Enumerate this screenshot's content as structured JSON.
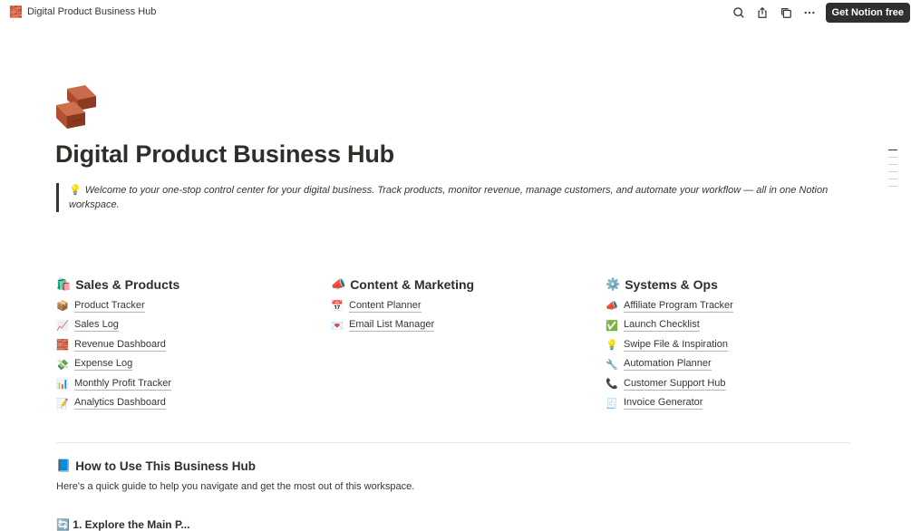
{
  "topbar": {
    "page_emoji": "🧱",
    "page_title": "Digital Product Business Hub",
    "cta_label": "Get Notion free"
  },
  "page": {
    "icon": "brick-icon",
    "title": "Digital Product Business Hub",
    "callout_emoji": "💡",
    "callout_text": "Welcome to your one-stop control center for your digital business. Track products, monitor revenue, manage customers, and automate your workflow — all in one Notion workspace."
  },
  "columns": [
    {
      "emoji": "🛍️",
      "heading": "Sales & Products",
      "links": [
        {
          "emoji": "📦",
          "label": "Product Tracker"
        },
        {
          "emoji": "📈",
          "label": "Sales Log"
        },
        {
          "emoji": "🧱",
          "label": "Revenue Dashboard"
        },
        {
          "emoji": "💸",
          "label": "Expense Log"
        },
        {
          "emoji": "📊",
          "label": "Monthly Profit Tracker"
        },
        {
          "emoji": "📝",
          "label": "Analytics Dashboard"
        }
      ]
    },
    {
      "emoji": "📣",
      "heading": "Content & Marketing",
      "links": [
        {
          "emoji": "📅",
          "label": "Content Planner"
        },
        {
          "emoji": "💌",
          "label": "Email List Manager"
        }
      ]
    },
    {
      "emoji": "⚙️",
      "heading": "Systems & Ops",
      "links": [
        {
          "emoji": "📣",
          "label": "Affiliate Program Tracker"
        },
        {
          "emoji": "✅",
          "label": "Launch Checklist"
        },
        {
          "emoji": "💡",
          "label": "Swipe File & Inspiration"
        },
        {
          "emoji": "🔧",
          "label": "Automation Planner"
        },
        {
          "emoji": "📞",
          "label": "Customer Support Hub"
        },
        {
          "emoji": "🧾",
          "label": "Invoice Generator"
        }
      ]
    }
  ],
  "how_to": {
    "emoji": "📘",
    "heading": "How to Use This Business Hub",
    "text": "Here's a quick guide to help you navigate and get the most out of this workspace.",
    "next_heading": "🔄 1. Explore the Main P..."
  }
}
